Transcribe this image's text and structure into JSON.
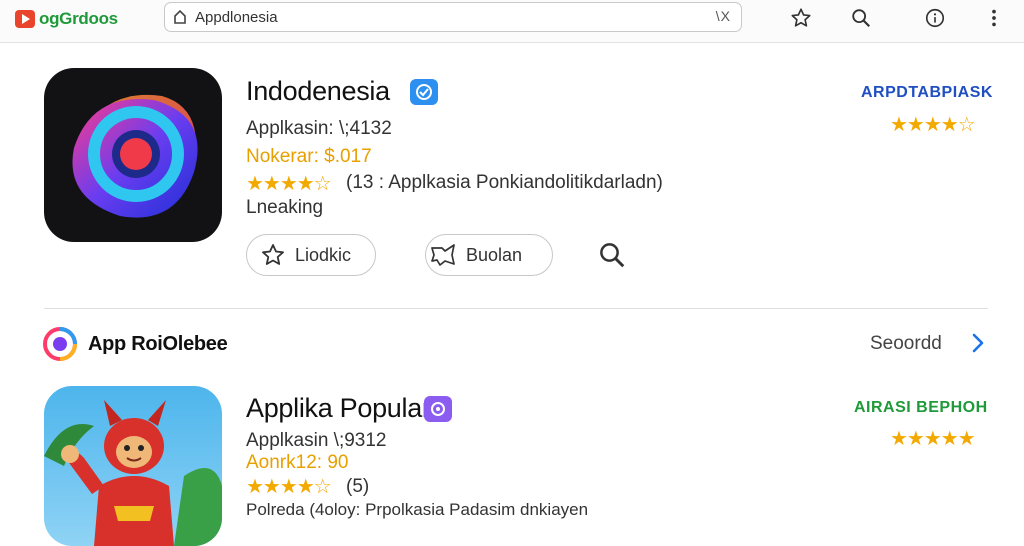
{
  "browser": {
    "logo_text": "ogGrdoos",
    "address_value": "Appdlonesia",
    "address_end": "\\X"
  },
  "app1": {
    "title": "Indodenesia",
    "developer_line": "Applkasin: \\;4132",
    "price_line": "Nokerar: $.017",
    "rating_text": "(13 : Applkasia Ponkiandolitikdarladn)",
    "status": "Lneaking",
    "stars": 4.5,
    "install_label": "Liodkic",
    "share_label": "Buolan",
    "right_label": "ARPDTABPIASK",
    "right_label_color": "#1f4fc0",
    "right_stars": 4.5
  },
  "section": {
    "title": "App RoiOlebee",
    "see_all": "Seoordd"
  },
  "app2": {
    "title": "Applika Popular",
    "developer_line": "Applkasin \\;9312",
    "price_line": "Aonrk12: 90",
    "rating_text": "(5)",
    "partial_line": "Polreda (4oloy: Prpolkasia Padasim dnkiayen",
    "stars": 4.5,
    "right_label": "AIRASI BEPHOH",
    "right_label_color": "#1f9a3a",
    "right_stars": 5
  },
  "colors": {
    "accent_blue": "#1a73e8",
    "star": "#f2a900"
  }
}
